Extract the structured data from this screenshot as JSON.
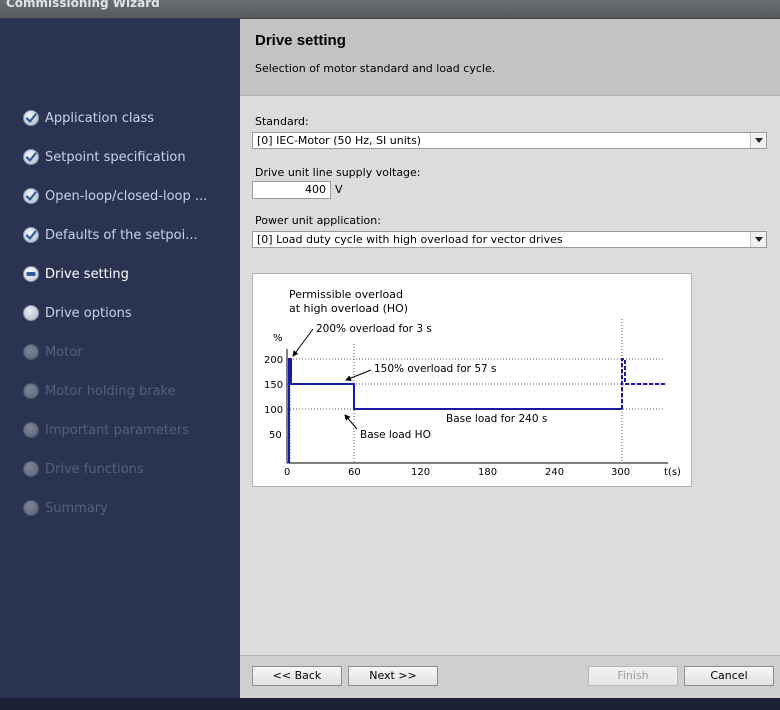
{
  "window": {
    "title": "Commissioning Wizard"
  },
  "sidebar": {
    "steps": [
      {
        "label": "Application class",
        "state": "done"
      },
      {
        "label": "Setpoint specification",
        "state": "done"
      },
      {
        "label": "Open-loop/closed-loop ...",
        "state": "done"
      },
      {
        "label": "Defaults of the setpoi...",
        "state": "done"
      },
      {
        "label": "Drive setting",
        "state": "current"
      },
      {
        "label": "Drive options",
        "state": "todo"
      },
      {
        "label": "Motor",
        "state": "disabled"
      },
      {
        "label": "Motor holding brake",
        "state": "disabled"
      },
      {
        "label": "Important parameters",
        "state": "disabled"
      },
      {
        "label": "Drive functions",
        "state": "disabled"
      },
      {
        "label": "Summary",
        "state": "disabled"
      }
    ]
  },
  "header": {
    "title": "Drive setting",
    "subtitle": "Selection of motor standard and load cycle."
  },
  "form": {
    "standard_label": "Standard:",
    "standard_value": "[0] IEC-Motor (50 Hz, SI units)",
    "voltage_label": "Drive unit line supply voltage:",
    "voltage_value": "400",
    "voltage_unit": "V",
    "power_label": "Power unit application:",
    "power_value": "[0] Load duty cycle with high overload for vector drives"
  },
  "diagram": {
    "heading_line1": "Permissible overload",
    "heading_line2": "at high overload (HO)",
    "y_unit": "%",
    "x_unit": "t(s)",
    "y_ticks": [
      "200",
      "150",
      "100",
      "50"
    ],
    "x_ticks": [
      "0",
      "60",
      "120",
      "180",
      "240",
      "300"
    ],
    "annotation_200": "200% overload for 3 s",
    "annotation_150": "150% overload for 57 s",
    "annotation_base": "Base load for 240 s",
    "annotation_base_ho": "Base load HO"
  },
  "footer": {
    "back": "<< Back",
    "next": "Next >>",
    "finish": "Finish",
    "cancel": "Cancel"
  },
  "colors": {
    "curve": "#1a1aa8",
    "sidebar": "#2a3452"
  }
}
